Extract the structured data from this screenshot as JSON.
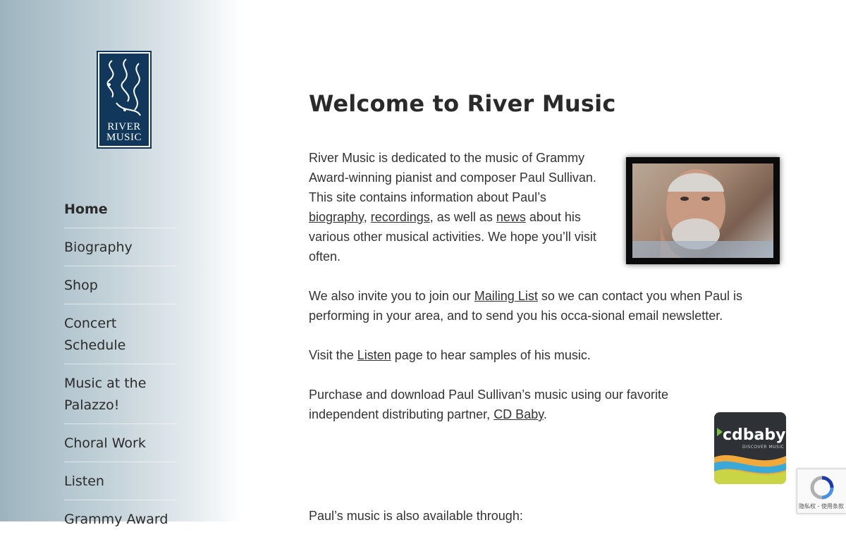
{
  "logo": {
    "line1": "RIVER",
    "line2": "MUSIC"
  },
  "nav": {
    "items": [
      {
        "label": "Home"
      },
      {
        "label": "Biography"
      },
      {
        "label": "Shop"
      },
      {
        "label": "Concert Schedule"
      },
      {
        "label": "Music at the Palazzo!"
      },
      {
        "label": "Choral Work"
      },
      {
        "label": "Listen"
      },
      {
        "label": "Grammy Award"
      }
    ]
  },
  "main": {
    "title": "Welcome to River Music",
    "p1": {
      "t1": "River Music is dedicated to the music of Grammy Award-winning pianist and composer Paul Sullivan. This site contains information about Paul’s ",
      "link_biography": "biography",
      "t2": ", ",
      "link_recordings": "recordings",
      "t3": ", as well as ",
      "link_news": "news",
      "t4": " about his various other musical activities. We hope you’ll visit often."
    },
    "p2": {
      "t1": "We also invite you to join our ",
      "link_mailing": "Mailing List",
      "t2": " so we can contact you when Paul is performing in your area, and to send you his occa-sional email newsletter."
    },
    "p3": {
      "t1": "Visit the ",
      "link_listen": "Listen",
      "t2": " page to hear samples of his music."
    },
    "p4": {
      "t1": "Purchase and download Paul Sullivan’s music using our favorite independent distributing partner, ",
      "link_cdbaby": "CD Baby",
      "t2": "."
    },
    "p5": "Paul’s music is also available through:"
  },
  "cdbaby": {
    "text": "cdbaby",
    "sub": "DISCOVER MUSIC"
  },
  "recaptcha": {
    "label": "隐私权 - 使用条款"
  },
  "colors": {
    "logo_navy": "#11385a",
    "text": "#333333"
  }
}
